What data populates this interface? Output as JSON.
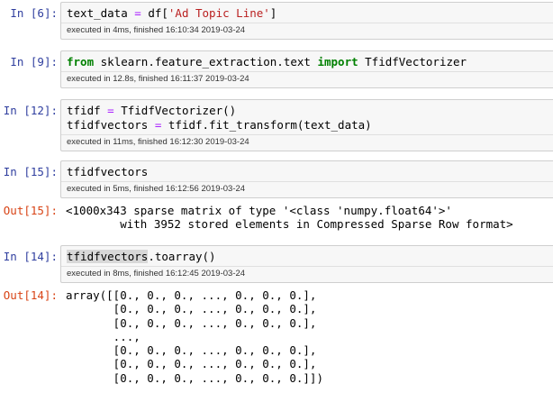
{
  "cells": [
    {
      "prompt": "In [6]:",
      "code": {
        "var": "text_data",
        "eq": "=",
        "call": "df[",
        "str": "'Ad Topic Line'",
        "close": "]"
      },
      "exec": "executed in 4ms, finished 16:10:34 2019-03-24"
    },
    {
      "prompt": "In [9]:",
      "code": {
        "kw_from": "from",
        "module": "sklearn.feature_extraction.text",
        "kw_import": "import",
        "name": "TfidfVectorizer"
      },
      "exec": "executed in 12.8s, finished 16:11:37 2019-03-24"
    },
    {
      "prompt": "In [12]:",
      "code": {
        "line1_var": "tfidf",
        "line1_eq": "=",
        "line1_rest": "TfidfVectorizer()",
        "line2_var": "tfidfvectors",
        "line2_eq": "=",
        "line2_rest": "tfidf.fit_transform(text_data)"
      },
      "exec": "executed in 11ms, finished 16:12:30 2019-03-24"
    },
    {
      "prompt": "In [15]:",
      "code": {
        "text": "tfidfvectors"
      },
      "exec": "executed in 5ms, finished 16:12:56 2019-03-24",
      "out_prompt": "Out[15]:",
      "output_lines": [
        "<1000x343 sparse matrix of type '<class 'numpy.float64'>'",
        "        with 3952 stored elements in Compressed Sparse Row format>"
      ]
    },
    {
      "prompt": "In [14]:",
      "code": {
        "highlighted": "tfidfvectors",
        "rest": ".toarray()"
      },
      "exec": "executed in 8ms, finished 16:12:45 2019-03-24",
      "out_prompt": "Out[14]:",
      "output_lines": [
        "array([[0., 0., 0., ..., 0., 0., 0.],",
        "       [0., 0., 0., ..., 0., 0., 0.],",
        "       [0., 0., 0., ..., 0., 0., 0.],",
        "       ...,",
        "       [0., 0., 0., ..., 0., 0., 0.],",
        "       [0., 0., 0., ..., 0., 0., 0.],",
        "       [0., 0., 0., ..., 0., 0., 0.]])"
      ]
    }
  ]
}
